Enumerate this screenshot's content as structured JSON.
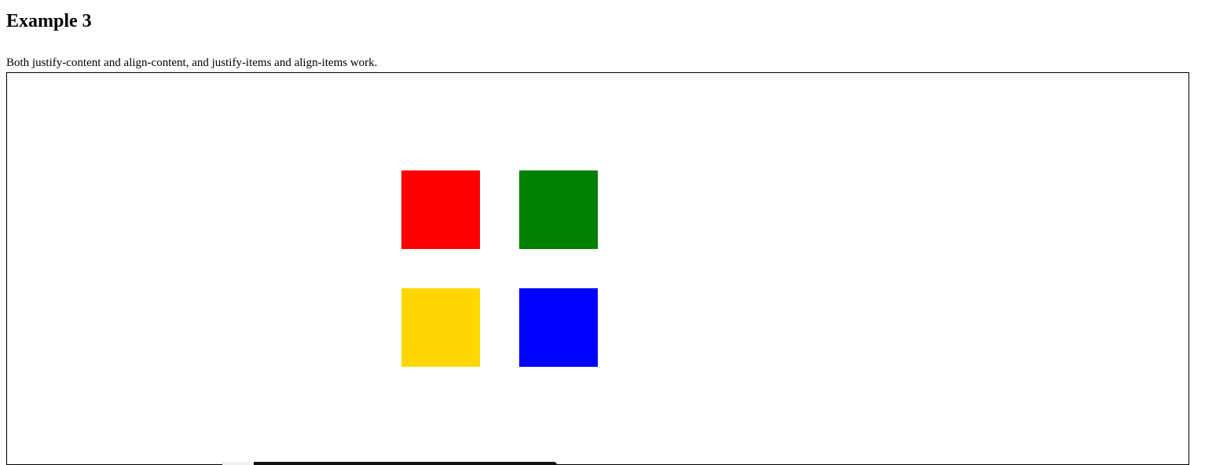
{
  "heading": "Example 3",
  "description": "Both justify-content and align-content, and justify-items and align-items work.",
  "grid": {
    "items": [
      {
        "name": "red",
        "color": "#ff0000"
      },
      {
        "name": "green",
        "color": "#008000"
      },
      {
        "name": "gold",
        "color": "#ffd700"
      },
      {
        "name": "blue",
        "color": "#0000ff"
      }
    ]
  }
}
